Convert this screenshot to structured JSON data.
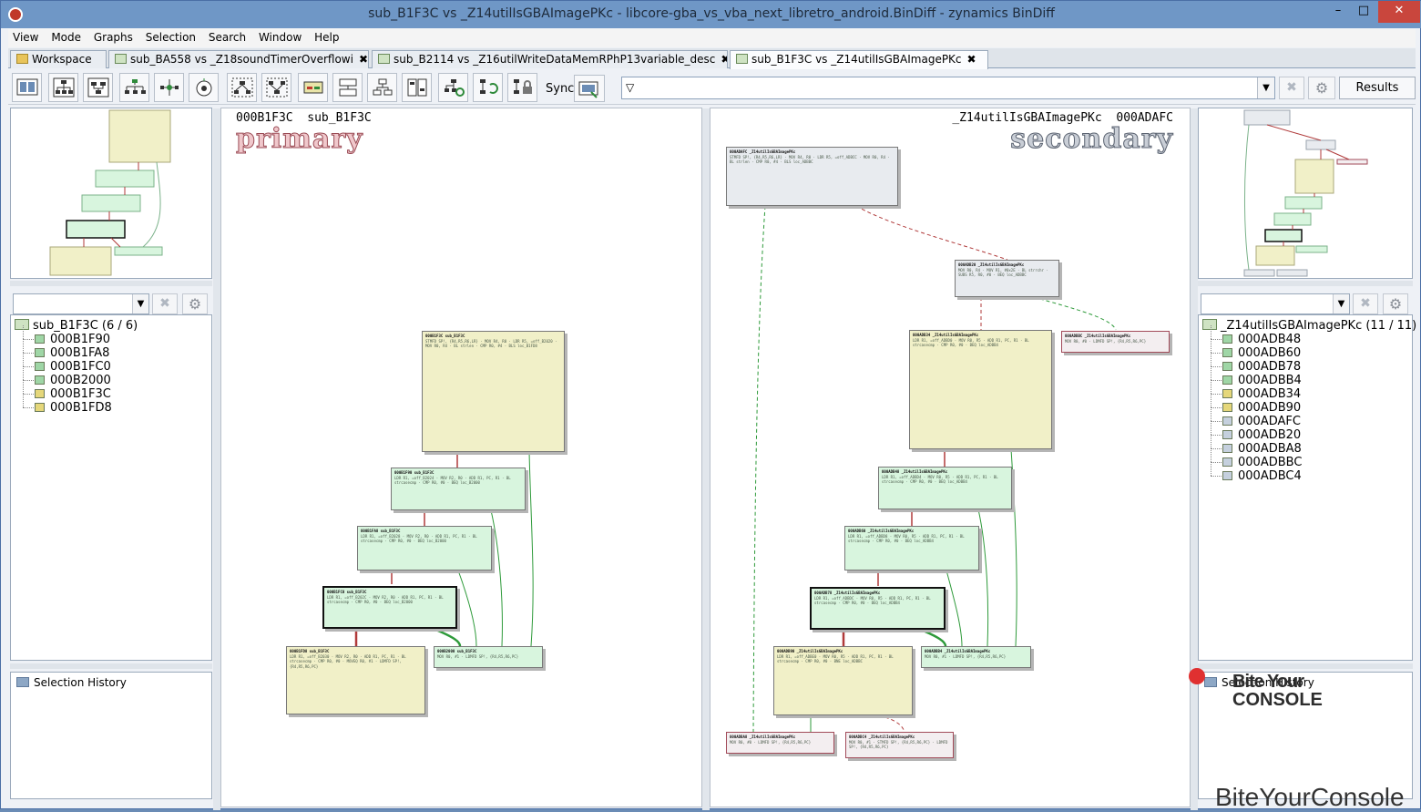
{
  "window": {
    "title": "sub_B1F3C vs _Z14utilIsGBAImagePKc - libcore-gba_vs_vba_next_libretro_android.BinDiff - zynamics BinDiff",
    "minimize": "–",
    "maximize": "□",
    "close": "✕"
  },
  "menu": [
    "View",
    "Mode",
    "Graphs",
    "Selection",
    "Search",
    "Window",
    "Help"
  ],
  "tabs": [
    {
      "label": "Workspace",
      "closable": false
    },
    {
      "label": "sub_BA558 vs _Z18soundTimerOverflowi",
      "closable": true
    },
    {
      "label": "sub_B2114 vs _Z16utilWriteDataMemRPhP13variable_desc",
      "closable": true
    },
    {
      "label": "sub_B1F3C vs _Z14utilIsGBAImagePKc",
      "closable": true,
      "active": true
    }
  ],
  "toolbar": {
    "sync_label": "Sync",
    "results_label": "Results"
  },
  "primary": {
    "address": "000B1F3C",
    "name": "sub_B1F3C",
    "label": "primary"
  },
  "secondary": {
    "address": "000ADAFC",
    "name": "_Z14utilIsGBAImagePKc",
    "label": "secondary"
  },
  "left_tree": {
    "root": "sub_B1F3C (6 / 6)",
    "items": [
      {
        "label": "000B1F90",
        "color": "#9fd6a6"
      },
      {
        "label": "000B1FA8",
        "color": "#9fd6a6"
      },
      {
        "label": "000B1FC0",
        "color": "#9fd6a6"
      },
      {
        "label": "000B2000",
        "color": "#9fd6a6"
      },
      {
        "label": "000B1F3C",
        "color": "#e5d77a"
      },
      {
        "label": "000B1FD8",
        "color": "#e5d77a"
      }
    ]
  },
  "right_tree": {
    "root": "_Z14utilIsGBAImagePKc (11 / 11)",
    "items": [
      {
        "label": "000ADB48",
        "color": "#9fd6a6"
      },
      {
        "label": "000ADB60",
        "color": "#9fd6a6"
      },
      {
        "label": "000ADB78",
        "color": "#9fd6a6"
      },
      {
        "label": "000ADBB4",
        "color": "#9fd6a6"
      },
      {
        "label": "000ADB34",
        "color": "#e5d77a"
      },
      {
        "label": "000ADB90",
        "color": "#e5d77a"
      },
      {
        "label": "000ADAFC",
        "color": "#c5d0de"
      },
      {
        "label": "000ADB20",
        "color": "#c5d0de"
      },
      {
        "label": "000ADBA8",
        "color": "#c5d0de"
      },
      {
        "label": "000ADBBC",
        "color": "#c5d0de"
      },
      {
        "label": "000ADBC4",
        "color": "#c5d0de"
      }
    ]
  },
  "selection_history": "Selection History",
  "watermark": {
    "line1": "Bite Your",
    "line2": "CONSOLE",
    "footer": "BiteYourConsole"
  },
  "blocks_primary": [
    {
      "head": "000B1F3C  sub_B1F3C",
      "body": "STMFD SP!, {R4,R5,R6,LR} · MOV R4, R0 · LDR R5, =off_B2020 · MOV R0, R4 · BL strlen · CMP R0, #4 · BLS loc_B1FD8"
    },
    {
      "head": "000B1F90  sub_B1F3C",
      "body": "LDR R1, =off_B2024 · MOV R2, R0 · ADD R1, PC, R1 · BL strcasecmp · CMP R0, #0 · BEQ loc_B2000"
    },
    {
      "head": "000B1FA8  sub_B1F3C",
      "body": "LDR R1, =off_B2028 · MOV R2, R0 · ADD R1, PC, R1 · BL strcasecmp · CMP R0, #0 · BEQ loc_B2000"
    },
    {
      "head": "000B1FC0  sub_B1F3C",
      "body": "LDR R1, =off_B202C · MOV R2, R0 · ADD R1, PC, R1 · BL strcasecmp · CMP R0, #0 · BEQ loc_B2000"
    },
    {
      "head": "000B1FD8  sub_B1F3C",
      "body": "LDR R1, =off_B2030 · MOV R2, R0 · ADD R1, PC, R1 · BL strcasecmp · CMP R0, #0 · MOVEQ R0, #1 · LDMFD SP!, {R4,R5,R6,PC}"
    },
    {
      "head": "000B2000  sub_B1F3C",
      "body": "MOV R0, #1 · LDMFD SP!, {R4,R5,R6,PC}"
    }
  ],
  "blocks_secondary": [
    {
      "head": "000ADAFC  _Z14utilIsGBAImagePKc",
      "body": "STMFD SP!, {R4,R5,R6,LR} · MOV R4, R0 · LDR R5, =off_ADBCC · MOV R0, R4 · BL strlen · CMP R0, #4 · BLS loc_ADBBC"
    },
    {
      "head": "000ADB20  _Z14utilIsGBAImagePKc",
      "body": "MOV R0, R4 · MOV R1, #0x2E · BL strrchr · SUBS R5, R0, #0 · BEQ loc_ADBBC"
    },
    {
      "head": "000ADBBC  _Z14utilIsGBAImagePKc",
      "body": "MOV R0, #0 · LDMFD SP!, {R4,R5,R6,PC}"
    },
    {
      "head": "000ADB34  _Z14utilIsGBAImagePKc",
      "body": "LDR R1, =off_ADBD0 · MOV R0, R5 · ADD R1, PC, R1 · BL strcasecmp · CMP R0, #0 · BEQ loc_ADBB4"
    },
    {
      "head": "000ADB48  _Z14utilIsGBAImagePKc",
      "body": "LDR R1, =off_ADBD4 · MOV R0, R5 · ADD R1, PC, R1 · BL strcasecmp · CMP R0, #0 · BEQ loc_ADBB4"
    },
    {
      "head": "000ADB60  _Z14utilIsGBAImagePKc",
      "body": "LDR R1, =off_ADBD8 · MOV R0, R5 · ADD R1, PC, R1 · BL strcasecmp · CMP R0, #0 · BEQ loc_ADBB4"
    },
    {
      "head": "000ADB78  _Z14utilIsGBAImagePKc",
      "body": "LDR R1, =off_ADBDC · MOV R0, R5 · ADD R1, PC, R1 · BL strcasecmp · CMP R0, #0 · BEQ loc_ADBB4"
    },
    {
      "head": "000ADB90  _Z14utilIsGBAImagePKc",
      "body": "LDR R1, =off_ADBE0 · MOV R0, R5 · ADD R1, PC, R1 · BL strcasecmp · CMP R0, #0 · BNE loc_ADBBC"
    },
    {
      "head": "000ADBB4  _Z14utilIsGBAImagePKc",
      "body": "MOV R0, #1 · LDMFD SP!, {R4,R5,R6,PC}"
    },
    {
      "head": "000ADBA8  _Z14utilIsGBAImagePKc",
      "body": "MOV R0, #0 · LDMFD SP!, {R4,R5,R6,PC}"
    },
    {
      "head": "000ADBC4  _Z14utilIsGBAImagePKc",
      "body": "MOV R0, #1 · STMFD SP!, {R4,R5,R6,PC} · LDMFD SP!, {R4,R5,R6,PC}"
    }
  ]
}
